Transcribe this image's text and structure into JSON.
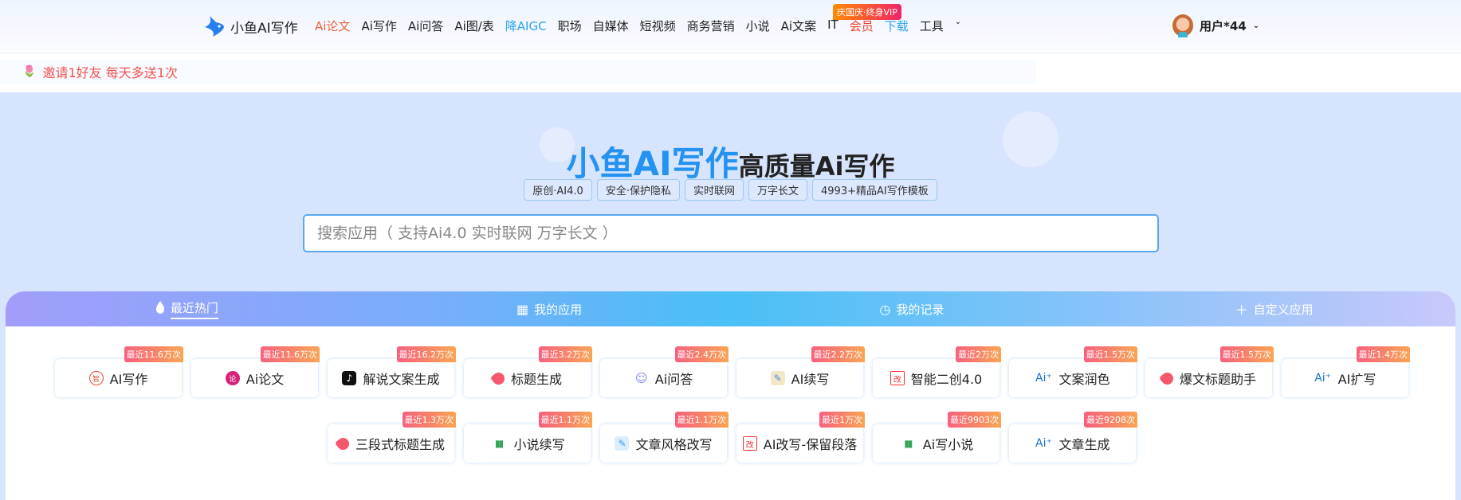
{
  "header": {
    "logo_text": "小鱼AI写作",
    "vip_badge": "庆国庆·终身VIP",
    "user_name": "用户*44",
    "nav": [
      {
        "label": "Ai论文",
        "color": "#f2603e"
      },
      {
        "label": "Ai写作",
        "color": "#222"
      },
      {
        "label": "Ai问答",
        "color": "#222"
      },
      {
        "label": "Ai图/表",
        "color": "#222"
      },
      {
        "label": "降AIGC",
        "color": "#2ba3f0"
      },
      {
        "label": "职场",
        "color": "#222"
      },
      {
        "label": "自媒体",
        "color": "#222"
      },
      {
        "label": "短视频",
        "color": "#222"
      },
      {
        "label": "商务营销",
        "color": "#222"
      },
      {
        "label": "小说",
        "color": "#222"
      },
      {
        "label": "Ai文案",
        "color": "#222"
      },
      {
        "label": "IT",
        "color": "#222"
      },
      {
        "label": "会员",
        "color": "#f2402e"
      },
      {
        "label": "下载",
        "color": "#2ba3f0"
      },
      {
        "label": "工具",
        "color": "#222"
      }
    ]
  },
  "invite": {
    "text": "邀请1好友 每天多送1次"
  },
  "hero": {
    "title_main": "小鱼AI写作",
    "title_sub": "高质量Ai写作",
    "tags": [
      "原创·AI4.0",
      "安全·保护隐私",
      "实时联网",
      "万字长文",
      "4993+精品AI写作模板"
    ],
    "search_placeholder": "搜索应用（ 支持Ai4.0 实时联网 万字长文 ）"
  },
  "tabs": [
    {
      "label": "最近热门",
      "icon": "flame-icon"
    },
    {
      "label": "我的应用",
      "icon": "grid-icon"
    },
    {
      "label": "我的记录",
      "icon": "clock-icon"
    },
    {
      "label": "自定义应用",
      "icon": "plus-icon"
    }
  ],
  "apps": [
    {
      "name": "AI写作",
      "badge": "最近11.6万次",
      "icon": "zhi-icon"
    },
    {
      "name": "Ai论文",
      "badge": "最近11.6万次",
      "icon": "lun-icon"
    },
    {
      "name": "解说文案生成",
      "badge": "最近16.2万次",
      "icon": "tiktok-icon"
    },
    {
      "name": "标题生成",
      "badge": "最近3.2万次",
      "icon": "tag-icon"
    },
    {
      "name": "Ai问答",
      "badge": "最近2.4万次",
      "icon": "robot-icon"
    },
    {
      "name": "AI续写",
      "badge": "最近2.2万次",
      "icon": "notepad-icon"
    },
    {
      "name": "智能二创4.0",
      "badge": "最近2万次",
      "icon": "gai-icon"
    },
    {
      "name": "文案润色",
      "badge": "最近1.5万次",
      "icon": "ai-spark-icon"
    },
    {
      "name": "爆文标题助手",
      "badge": "最近1.5万次",
      "icon": "tag-icon"
    },
    {
      "name": "AI扩写",
      "badge": "最近1.4万次",
      "icon": "ai-spark-icon"
    },
    {
      "name": "三段式标题生成",
      "badge": "最近1.3万次",
      "icon": "tag-icon"
    },
    {
      "name": "小说续写",
      "badge": "最近1.1万次",
      "icon": "book-icon"
    },
    {
      "name": "文章风格改写",
      "badge": "最近1.1万次",
      "icon": "edit-icon"
    },
    {
      "name": "AI改写-保留段落",
      "badge": "最近1万次",
      "icon": "gai-icon"
    },
    {
      "name": "Ai写小说",
      "badge": "最近9903次",
      "icon": "book-icon"
    },
    {
      "name": "文章生成",
      "badge": "最近9208次",
      "icon": "ai-spark-icon"
    }
  ]
}
